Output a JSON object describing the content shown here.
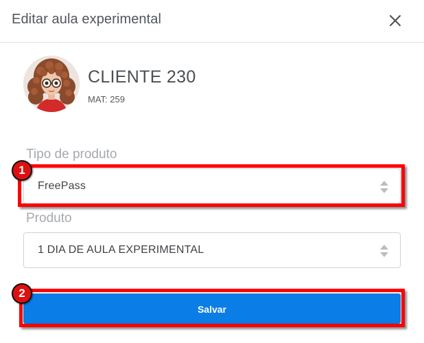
{
  "header": {
    "title": "Editar aula experimental",
    "close_icon": "close-icon"
  },
  "client": {
    "name": "CLIENTE 230",
    "mat": "MAT: 259",
    "avatar_icon": "avatar"
  },
  "form": {
    "product_type": {
      "label": "Tipo de produto",
      "value": "FreePass"
    },
    "product": {
      "label": "Produto",
      "value": "1 DIA DE AULA EXPERIMENTAL"
    },
    "save_label": "Salvar"
  },
  "annotations": {
    "badge_1": "1",
    "badge_2": "2"
  },
  "colors": {
    "primary_button": "#0a7de6",
    "highlight": "#ff0000",
    "title_text": "#51555a",
    "label_text": "#a5a9ae"
  }
}
